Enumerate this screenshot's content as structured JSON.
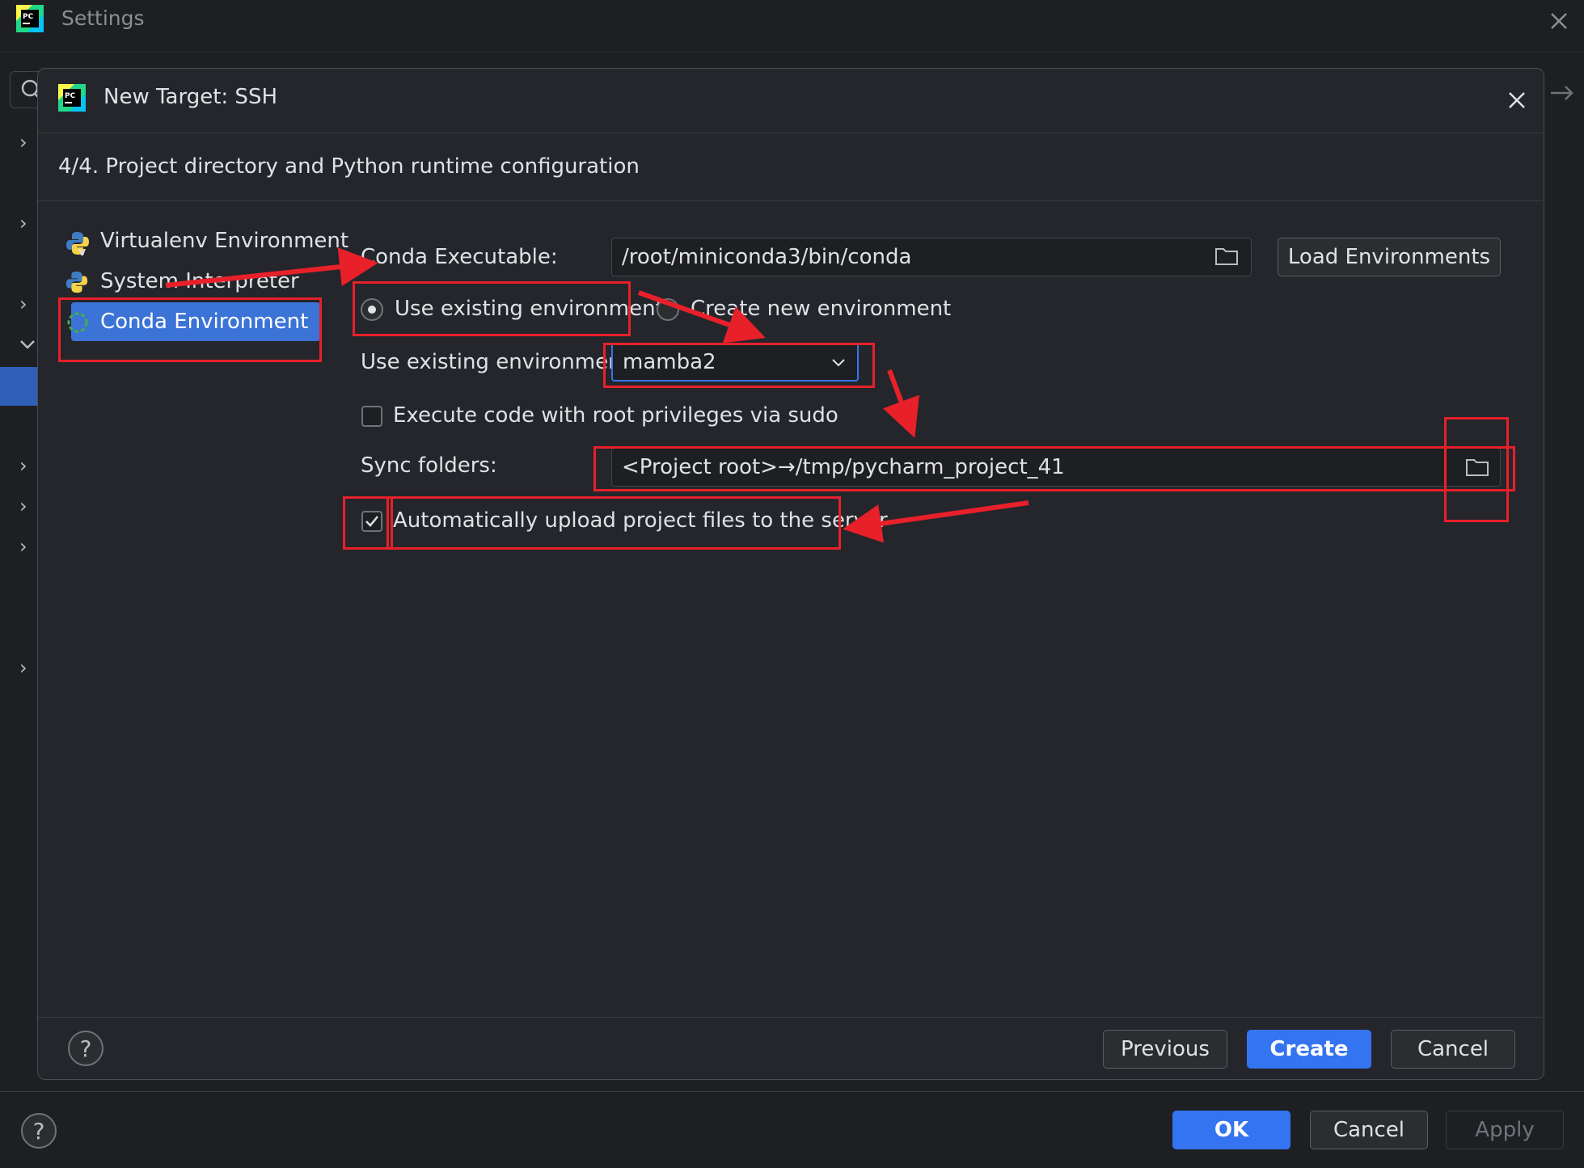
{
  "window": {
    "title": "Settings"
  },
  "dialog": {
    "title": "New Target: SSH",
    "step_label": "4/4. Project directory and Python runtime configuration"
  },
  "environments": {
    "items": [
      {
        "label": "Virtualenv Environment",
        "icon": "python-venv-icon"
      },
      {
        "label": "System Interpreter",
        "icon": "python-icon"
      },
      {
        "label": "Conda Environment",
        "icon": "conda-icon",
        "selected": true
      }
    ]
  },
  "conda": {
    "executable_label": "Conda Executable:",
    "executable_value": "/root/miniconda3/bin/conda",
    "load_button": "Load Environments",
    "radio_existing": "Use existing environment",
    "radio_new": "Create new environment",
    "existing_label": "Use existing environment:",
    "existing_value": "mamba2",
    "sudo_label": "Execute code with root privileges via sudo",
    "sudo_checked": false,
    "sync_label": "Sync folders:",
    "sync_value": "<Project root>→/tmp/pycharm_project_41",
    "upload_label": "Automatically upload project files to the server",
    "upload_checked": true
  },
  "dialog_buttons": {
    "previous": "Previous",
    "create": "Create",
    "cancel": "Cancel"
  },
  "outer_buttons": {
    "ok": "OK",
    "cancel": "Cancel",
    "apply": "Apply"
  },
  "help": "?",
  "colors": {
    "background": "#1e1f22",
    "dialog": "#24262b",
    "accent": "#3574f0",
    "selection": "#3b73d6",
    "annotation": "#e8202a"
  }
}
